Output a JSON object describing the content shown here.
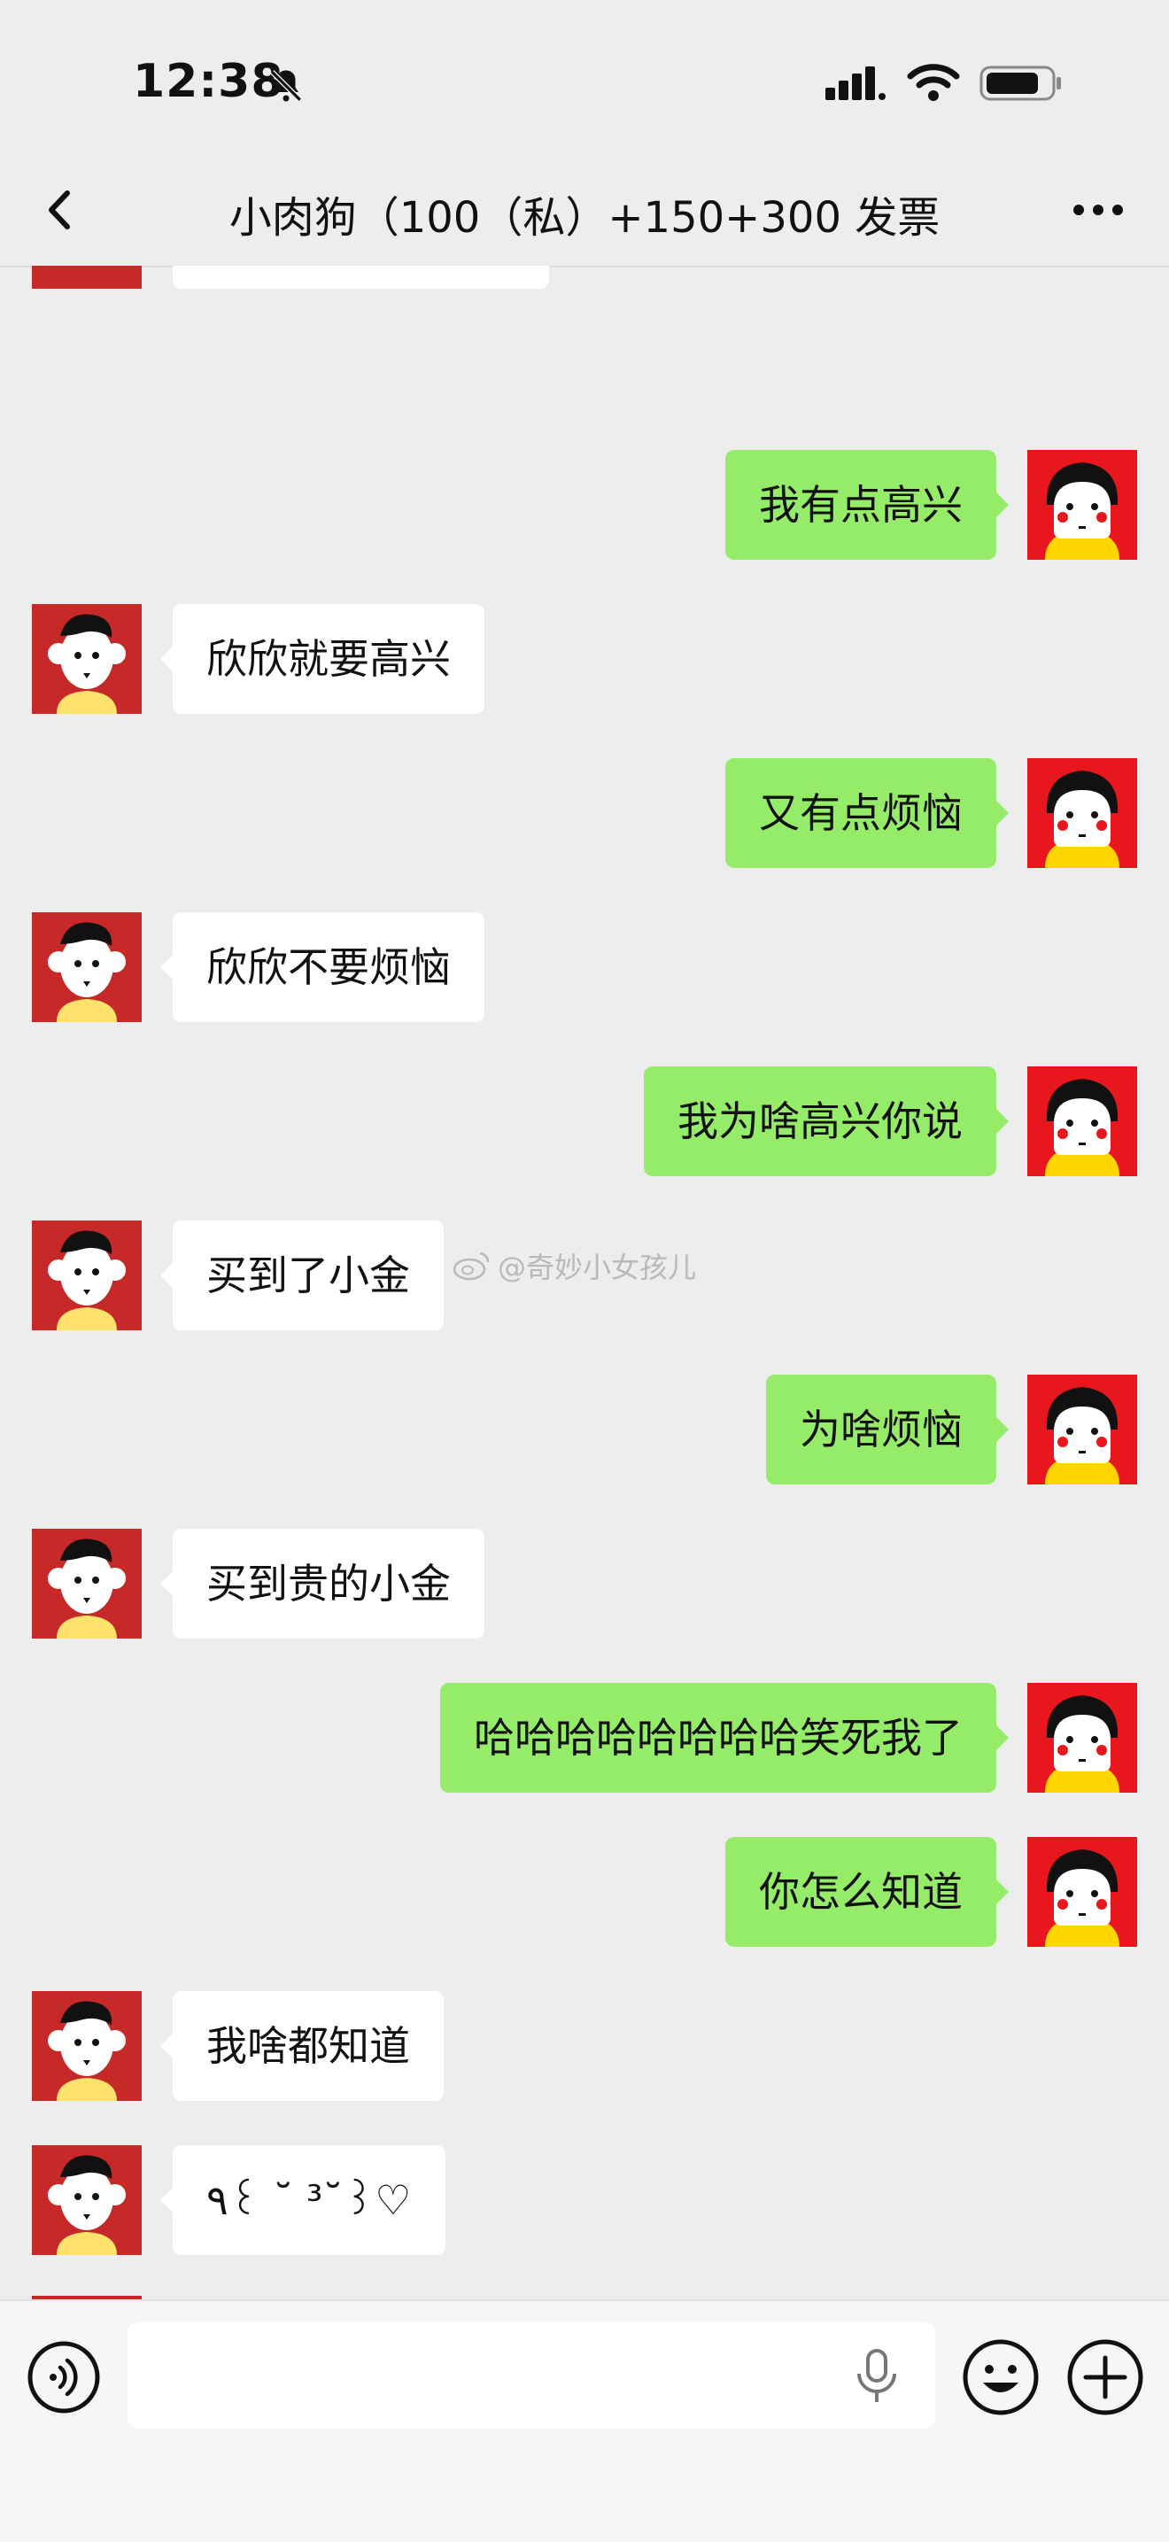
{
  "status_bar": {
    "time": "12:38"
  },
  "nav": {
    "title": "小肉狗（100（私）+150+300 发票"
  },
  "messages": [
    {
      "from": "me",
      "text": "我有点高兴"
    },
    {
      "from": "them",
      "text": "欣欣就要高兴"
    },
    {
      "from": "me",
      "text": "又有点烦恼"
    },
    {
      "from": "them",
      "text": "欣欣不要烦恼"
    },
    {
      "from": "me",
      "text": "我为啥高兴你说"
    },
    {
      "from": "them",
      "text": "买到了小金"
    },
    {
      "from": "me",
      "text": "为啥烦恼"
    },
    {
      "from": "them",
      "text": "买到贵的小金"
    },
    {
      "from": "me",
      "text": "哈哈哈哈哈哈哈哈笑死我了"
    },
    {
      "from": "me",
      "text": "你怎么知道"
    },
    {
      "from": "them",
      "text": "我啥都知道"
    },
    {
      "from": "them",
      "text": "٩꒰ ˘ ³˘꒱♡"
    }
  ],
  "watermark": {
    "text": "@奇妙小女孩儿"
  },
  "input_bar": {
    "placeholder": ""
  },
  "colors": {
    "my_bubble": "#95ec69",
    "their_bubble": "#ffffff",
    "background": "#ededed"
  }
}
